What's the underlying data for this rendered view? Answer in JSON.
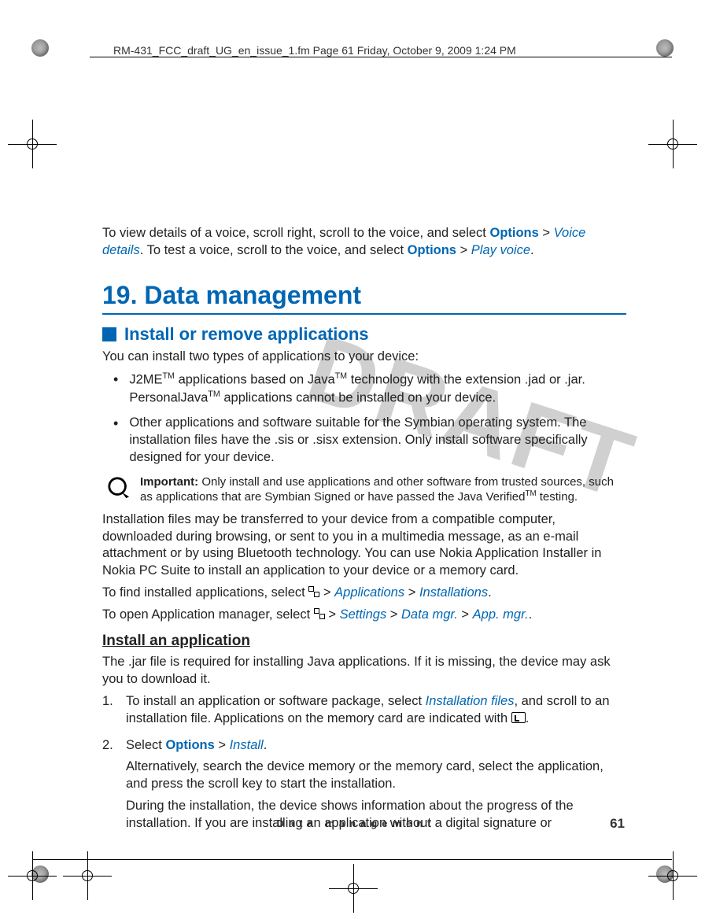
{
  "crop_header": "RM-431_FCC_draft_UG_en_issue_1.fm  Page 61  Friday, October 9, 2009  1:24 PM",
  "watermark": "DRAFT",
  "intro": {
    "p1_a": "To view details of a voice, scroll right, scroll to the voice, and select ",
    "options": "Options",
    "gt": " > ",
    "voice_details": "Voice details",
    "p1_b": ". To test a voice, scroll to the voice, and select ",
    "play_voice": "Play voice",
    "dot": "."
  },
  "chapter": "19. Data management",
  "section1": "Install or remove applications",
  "p2": "You can install two types of applications to your device:",
  "bullets": {
    "b1_a": "J2ME",
    "tm": "TM",
    "b1_b": " applications based on Java",
    "b1_c": " technology with the extension .jad or .jar. PersonalJava",
    "b1_d": " applications cannot be installed on your device.",
    "b2": "Other applications and software suitable for the Symbian operating system. The installation files have the .sis or .sisx extension. Only install software specifically designed for your device."
  },
  "note": {
    "label": "Important:",
    "text_a": " Only install and use applications and other software from trusted sources, such as applications that are Symbian Signed or have passed the Java Verified",
    "text_b": " testing."
  },
  "p3": "Installation files may be transferred to your device from a compatible computer, downloaded during browsing, or sent to you in a multimedia message, as an e-mail attachment or by using Bluetooth technology. You can use Nokia Application Installer in Nokia PC Suite to install an application to your device or a memory card.",
  "p4": {
    "a": "To find installed applications, select ",
    "b": " > ",
    "applications": "Applications",
    "installations": "Installations",
    "dot": "."
  },
  "p5": {
    "a": "To open Application manager, select ",
    "b": " > ",
    "settings": "Settings",
    "datamgr": "Data mgr.",
    "appmgr": "App. mgr.",
    "dot": "."
  },
  "sub1": "Install an application",
  "p6": "The .jar file is required for installing Java applications. If it is missing, the device may ask you to download it.",
  "steps": {
    "s1_num": "1.",
    "s1_a": "To install an application or software package, select ",
    "installation_files": "Installation files",
    "s1_b": ", and scroll to an installation file. Applications on the memory card are indicated with ",
    "s1_c": ".",
    "s2_num": "2.",
    "s2_a": "Select ",
    "options": "Options",
    "gt": " > ",
    "install": "Install",
    "dot": ".",
    "s2_p2": "Alternatively, search the device memory or the memory card, select the application, and press the scroll key to start the installation.",
    "s2_p3": "During the installation, the device shows information about the progress of the installation. If you are installing an application without a digital signature or"
  },
  "footer": {
    "section": "Data management",
    "page": "61"
  }
}
